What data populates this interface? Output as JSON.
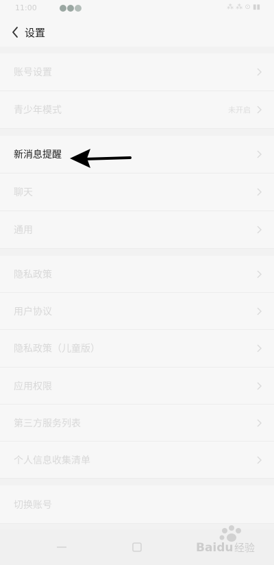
{
  "status_bar": {
    "time": "11:00",
    "right": "⁂ ⁂ ⊙ ▮▮"
  },
  "header": {
    "title": "设置"
  },
  "groups": [
    {
      "rows": [
        {
          "label": "账号设置",
          "value": ""
        },
        {
          "label": "青少年模式",
          "value": "未开启"
        }
      ]
    },
    {
      "rows": [
        {
          "label": "新消息提醒",
          "value": "",
          "highlighted": true
        },
        {
          "label": "聊天",
          "value": ""
        },
        {
          "label": "通用",
          "value": ""
        }
      ]
    },
    {
      "rows": [
        {
          "label": "隐私政策",
          "value": ""
        },
        {
          "label": "用户协议",
          "value": ""
        },
        {
          "label": "隐私政策（儿童版）",
          "value": ""
        },
        {
          "label": "应用权限",
          "value": ""
        },
        {
          "label": "第三方服务列表",
          "value": ""
        },
        {
          "label": "个人信息收集清单",
          "value": ""
        }
      ]
    },
    {
      "rows": [
        {
          "label": "切换账号",
          "value": ""
        }
      ]
    }
  ],
  "annotation": {
    "icon": "arrow-left-icon",
    "color": "#000000"
  },
  "watermark": {
    "text": "Baidu 经验",
    "icon": "paw-icon"
  },
  "colors": {
    "background": "#f2f2f2",
    "row_bg": "#f7f7f7",
    "faded_text": "#d8d8d8",
    "active_text": "#1e1e1e"
  }
}
